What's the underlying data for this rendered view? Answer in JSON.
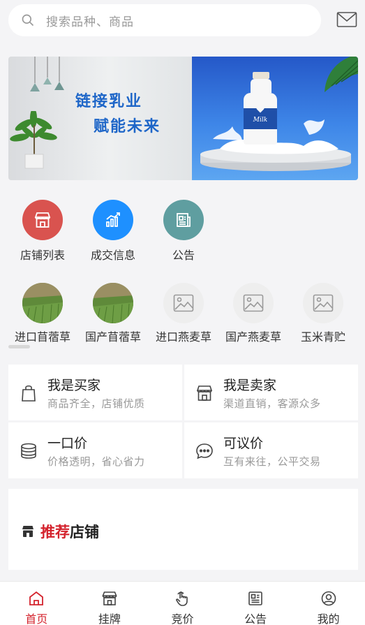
{
  "search": {
    "placeholder": "搜索品种、商品"
  },
  "banner": {
    "line1": "链接乳业",
    "line2": "赋能未来",
    "bottle_label": "Milk"
  },
  "quick_links": [
    {
      "label": "店铺列表",
      "icon": "store-icon",
      "color": "#d9534f"
    },
    {
      "label": "成交信息",
      "icon": "chart-icon",
      "color": "#1e90ff"
    },
    {
      "label": "公告",
      "icon": "notice-icon",
      "color": "#5f9ea0"
    }
  ],
  "categories": [
    {
      "label": "进口苜蓿草",
      "icon": "alfalfa-photo"
    },
    {
      "label": "国产苜蓿草",
      "icon": "alfalfa-photo"
    },
    {
      "label": "进口燕麦草",
      "icon": "image-placeholder-icon"
    },
    {
      "label": "国产燕麦草",
      "icon": "image-placeholder-icon"
    },
    {
      "label": "玉米青贮",
      "icon": "image-placeholder-icon"
    }
  ],
  "roles": [
    {
      "title": "我是买家",
      "subtitle": "商品齐全，店铺优质",
      "icon": "shopping-bag-icon"
    },
    {
      "title": "我是卖家",
      "subtitle": "渠道直销，客源众多",
      "icon": "shop-icon"
    },
    {
      "title": "一口价",
      "subtitle": "价格透明，省心省力",
      "icon": "coins-icon"
    },
    {
      "title": "可议价",
      "subtitle": "互有来往，公平交易",
      "icon": "chat-icon"
    }
  ],
  "recommend": {
    "highlight": "推荐",
    "rest": "店铺"
  },
  "tabs": [
    {
      "label": "首页",
      "icon": "home-icon",
      "active": true
    },
    {
      "label": "挂牌",
      "icon": "listing-icon",
      "active": false
    },
    {
      "label": "竞价",
      "icon": "bid-icon",
      "active": false
    },
    {
      "label": "公告",
      "icon": "announcement-icon",
      "active": false
    },
    {
      "label": "我的",
      "icon": "profile-icon",
      "active": false
    }
  ],
  "colors": {
    "accent": "#d4232d",
    "banner_text": "#1e66c8"
  }
}
